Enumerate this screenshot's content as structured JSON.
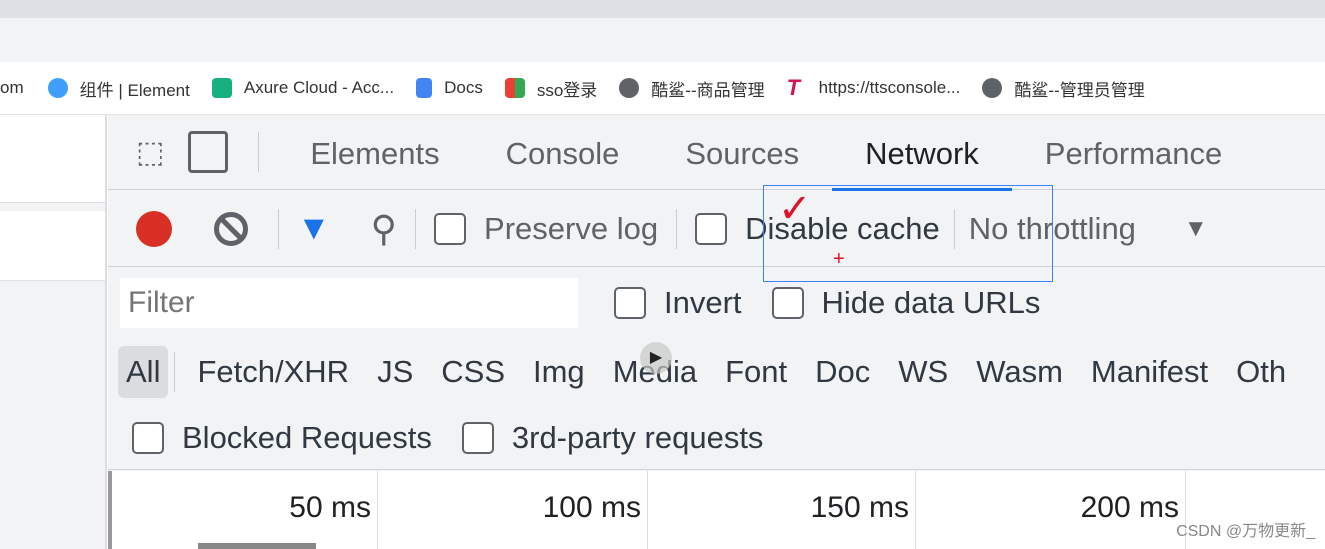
{
  "bookmarks": [
    {
      "label": "om",
      "icon": "none"
    },
    {
      "label": "组件 | Element",
      "icon": "element-icon",
      "color": "#409eff"
    },
    {
      "label": "Axure Cloud - Acc...",
      "icon": "axure-icon",
      "color": "#17b07f"
    },
    {
      "label": "Docs",
      "icon": "docs-icon",
      "color": "#4285f4"
    },
    {
      "label": "sso登录",
      "icon": "sso-icon",
      "color": "#e94235"
    },
    {
      "label": "酷鲨--商品管理",
      "icon": "globe-icon",
      "color": "#5f6368"
    },
    {
      "label": "https://ttsconsole...",
      "icon": "tts-icon",
      "color": "#d6134e"
    },
    {
      "label": "酷鲨--管理员管理",
      "icon": "globe-icon",
      "color": "#5f6368"
    }
  ],
  "devtools": {
    "tabs": [
      "Elements",
      "Console",
      "Sources",
      "Network",
      "Performance"
    ],
    "active_tab": "Network",
    "toolbar": {
      "preserve_log": "Preserve log",
      "disable_cache": "Disable cache",
      "throttling": "No throttling",
      "record_color": "#d93025",
      "filter_color": "#1a73e8"
    },
    "filter": {
      "placeholder": "Filter",
      "invert": "Invert",
      "hide_data_urls": "Hide data URLs"
    },
    "types": [
      "All",
      "Fetch/XHR",
      "JS",
      "CSS",
      "Img",
      "Media",
      "Font",
      "Doc",
      "WS",
      "Wasm",
      "Manifest",
      "Oth"
    ],
    "blocked": "Blocked Requests",
    "third_party": "3rd-party requests",
    "timeline": [
      "50 ms",
      "100 ms",
      "150 ms",
      "200 ms"
    ]
  },
  "watermark": "CSDN @万物更新_"
}
